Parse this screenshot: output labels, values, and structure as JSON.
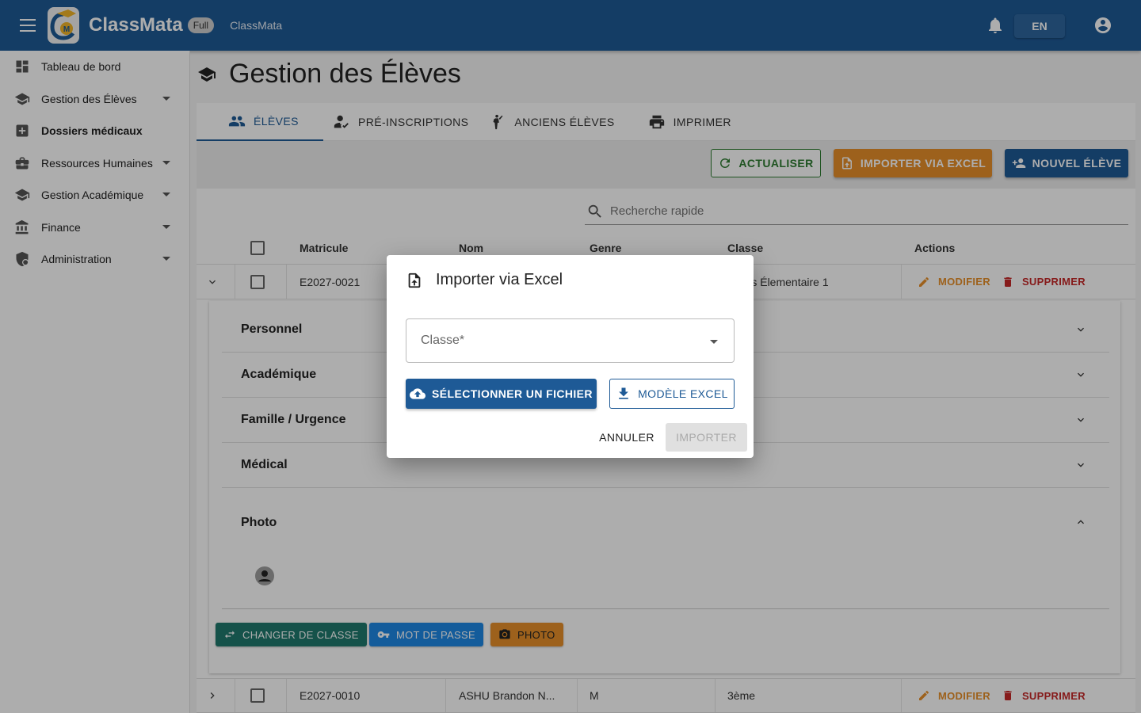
{
  "appbar": {
    "brand": "ClassMata",
    "plan_badge": "Full",
    "breadcrumb": "ClassMata",
    "language": "EN",
    "colors": {
      "primary": "#1e5a96"
    }
  },
  "sidebar": {
    "items": [
      {
        "label": "Tableau de bord",
        "icon": "dashboard-icon"
      },
      {
        "label": "Gestion des Élèves",
        "icon": "school-icon"
      },
      {
        "label": "Dossiers médicaux",
        "icon": "medical-icon"
      },
      {
        "label": "Ressources Humaines",
        "icon": "briefcase-icon"
      },
      {
        "label": "Gestion Académique",
        "icon": "school-icon"
      },
      {
        "label": "Finance",
        "icon": "bank-icon"
      },
      {
        "label": "Administration",
        "icon": "admin-shield-icon"
      }
    ]
  },
  "page": {
    "title": "Gestion des Élèves",
    "tabs": [
      {
        "label": "ÉLÈVES",
        "icon": "people-icon"
      },
      {
        "label": "PRÉ-INSCRIPTIONS",
        "icon": "person-check-icon"
      },
      {
        "label": "ANCIENS ÉLÈVES",
        "icon": "person-wave-icon"
      },
      {
        "label": "IMPRIMER",
        "icon": "printer-icon"
      }
    ],
    "toolbar": {
      "refresh_label": "ACTUALISER",
      "import_label": "IMPORTER VIA EXCEL",
      "new_label": "NOUVEL ÉLÈVE"
    },
    "search": {
      "placeholder": "Recherche rapide"
    },
    "table": {
      "columns": [
        "Matricule",
        "Nom",
        "Genre",
        "Classe",
        "Actions"
      ],
      "rows": [
        {
          "matricule": "E2027-0021",
          "nom": "",
          "genre": "",
          "classe": "Cours Élementaire 1"
        },
        {
          "matricule": "E2027-0010",
          "nom": "ASHU Brandon N...",
          "genre": "M",
          "classe": "3ème"
        }
      ],
      "action_edit": "MODIFIER",
      "action_delete": "SUPPRIMER"
    },
    "detail": {
      "sections": [
        "Personnel",
        "Académique",
        "Famille / Urgence",
        "Médical"
      ],
      "photo_section": "Photo",
      "buttons": {
        "change_class": "CHANGER DE CLASSE",
        "password": "MOT DE PASSE",
        "photo": "PHOTO"
      }
    }
  },
  "dialog": {
    "title": "Importer via Excel",
    "select_placeholder": "Classe*",
    "select_file_label": "SÉLECTIONNER UN FICHIER",
    "template_label": "MODÈLE EXCEL",
    "cancel_label": "ANNULER",
    "import_label": "IMPORTER"
  }
}
